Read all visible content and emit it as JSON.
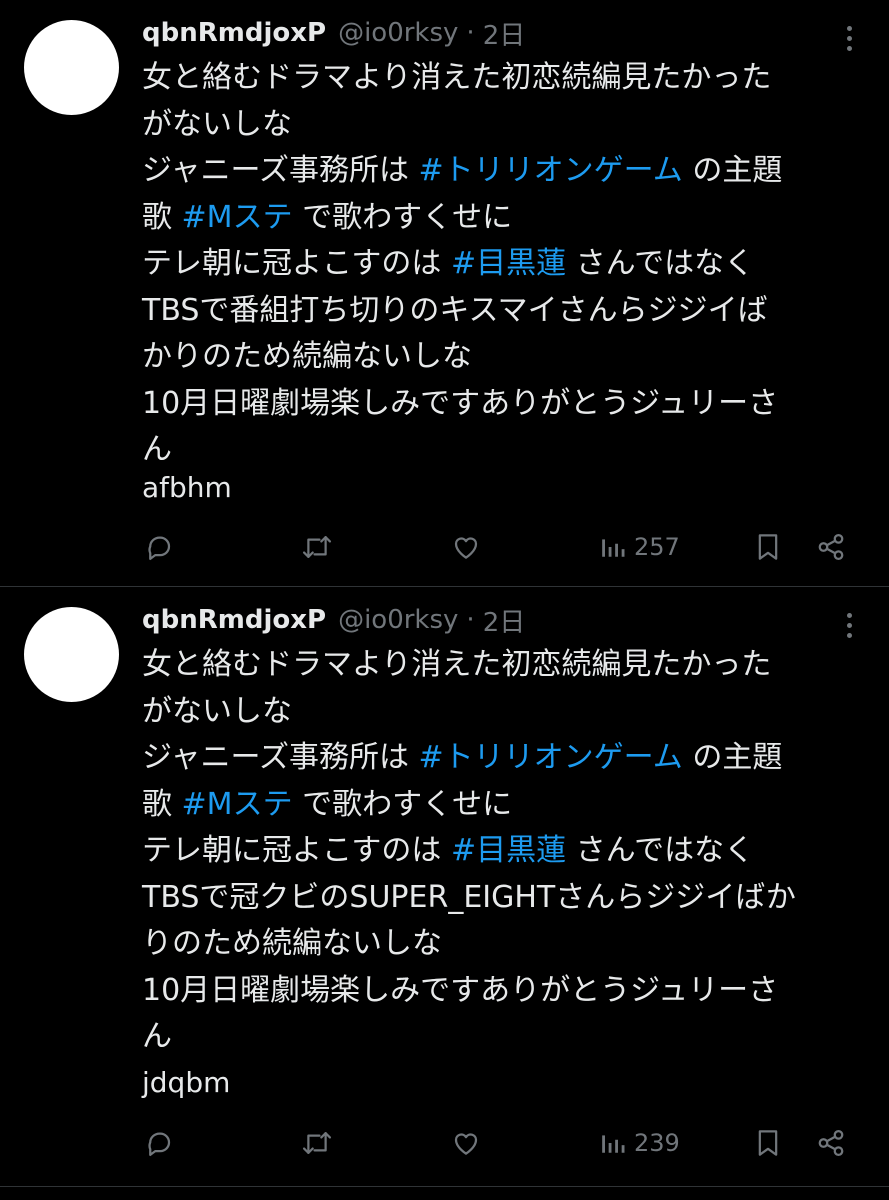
{
  "tweets": [
    {
      "display_name": "qbnRmdjoxP",
      "handle": "@io0rksy",
      "separator": "·",
      "time": "2日",
      "lines": [
        [
          {
            "t": "女と絡むドラマより消えた初恋続編見たかった"
          }
        ],
        [
          {
            "t": "がないしな"
          }
        ],
        [
          {
            "t": "ジャニーズ事務所は "
          },
          {
            "t": "#トリリオンゲーム",
            "tag": true
          },
          {
            "t": " の主題"
          }
        ],
        [
          {
            "t": "歌 "
          },
          {
            "t": "#Mステ",
            "tag": true
          },
          {
            "t": " で歌わすくせに"
          }
        ],
        [
          {
            "t": "テレ朝に冠よこすのは "
          },
          {
            "t": "#目黒蓮",
            "tag": true
          },
          {
            "t": " さんではなく"
          }
        ],
        [
          {
            "t": "TBSで番組打ち切りのキスマイさんらジジイば"
          }
        ],
        [
          {
            "t": "かりのため続編ないしな"
          }
        ],
        [
          {
            "t": "10月日曜劇場楽しみですありがとうジュリーさ"
          }
        ],
        [
          {
            "t": "ん"
          }
        ]
      ],
      "signature": "afbhm",
      "views": "257"
    },
    {
      "display_name": "qbnRmdjoxP",
      "handle": "@io0rksy",
      "separator": "·",
      "time": "2日",
      "lines": [
        [
          {
            "t": "女と絡むドラマより消えた初恋続編見たかった"
          }
        ],
        [
          {
            "t": "がないしな"
          }
        ],
        [
          {
            "t": "ジャニーズ事務所は "
          },
          {
            "t": "#トリリオンゲーム",
            "tag": true
          },
          {
            "t": " の主題"
          }
        ],
        [
          {
            "t": "歌 "
          },
          {
            "t": "#Mステ",
            "tag": true
          },
          {
            "t": " で歌わすくせに"
          }
        ],
        [
          {
            "t": "テレ朝に冠よこすのは "
          },
          {
            "t": "#目黒蓮",
            "tag": true
          },
          {
            "t": " さんではなく"
          }
        ],
        [
          {
            "t": "TBSで冠クビのSUPER_EIGHTさんらジジイばか"
          }
        ],
        [
          {
            "t": "りのため続編ないしな"
          }
        ],
        [
          {
            "t": "10月日曜劇場楽しみですありがとうジュリーさ"
          }
        ],
        [
          {
            "t": "ん"
          }
        ]
      ],
      "signature": "jdqbm",
      "views": "239"
    }
  ],
  "icons": {
    "more": "more-icon",
    "reply": "reply-icon",
    "retweet": "retweet-icon",
    "like": "like-icon",
    "views": "views-icon",
    "bookmark": "bookmark-icon",
    "share": "share-icon"
  },
  "colors": {
    "background": "#000000",
    "text": "#e7e9ea",
    "muted": "#71767b",
    "hashtag": "#1d9bf0",
    "divider": "#2f3336"
  }
}
